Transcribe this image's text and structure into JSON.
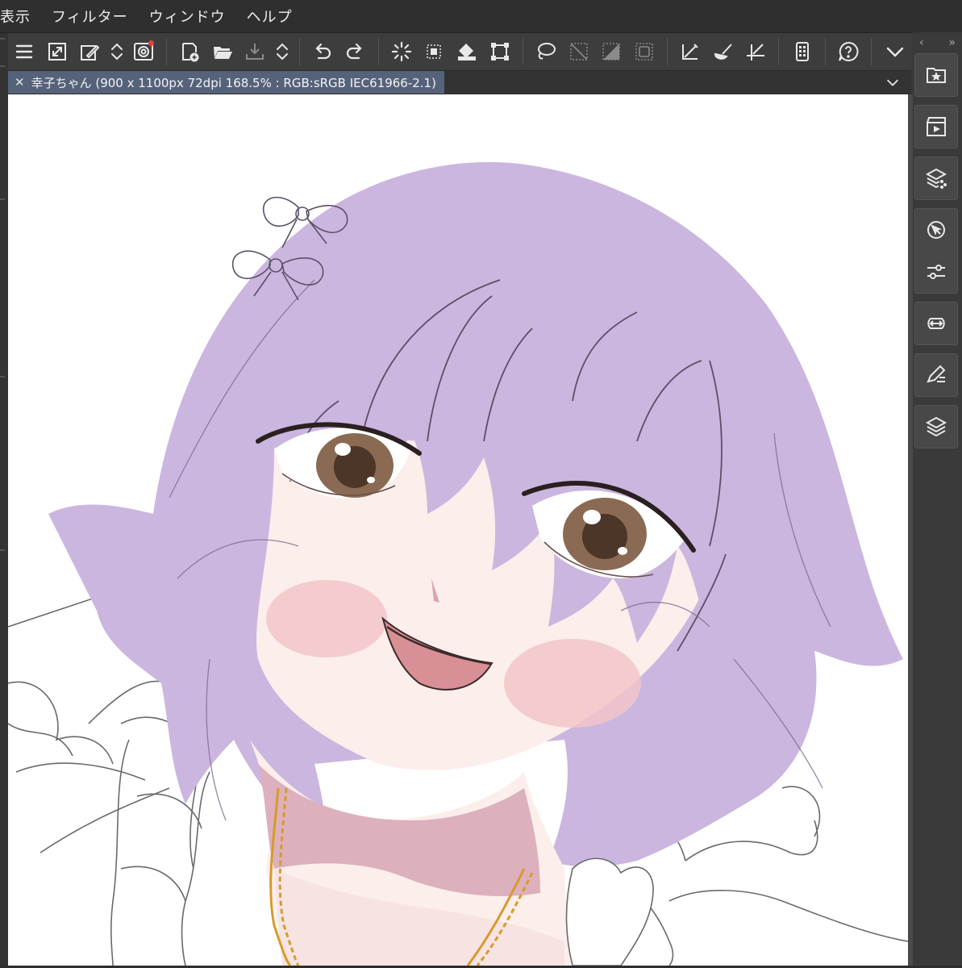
{
  "menu": {
    "items": [
      "表示",
      "フィルター",
      "ウィンドウ",
      "ヘルプ"
    ]
  },
  "toolbar": {
    "buttons": [
      {
        "icon": "menu-icon"
      },
      {
        "icon": "resize-icon"
      },
      {
        "icon": "eyedropper-icon"
      },
      {
        "icon": "up-down-arrows-icon"
      },
      {
        "icon": "clip-studio-logo-icon",
        "notification": true
      },
      {
        "icon": "new-canvas-icon"
      },
      {
        "icon": "open-folder-icon"
      },
      {
        "icon": "save-icon"
      },
      {
        "icon": "up-down-arrows-icon"
      },
      {
        "icon": "undo-icon"
      },
      {
        "icon": "redo-icon"
      },
      {
        "icon": "loading-spinner-icon"
      },
      {
        "icon": "selection-dots-icon"
      },
      {
        "icon": "fill-bucket-icon"
      },
      {
        "icon": "transform-icon"
      },
      {
        "icon": "lasso-icon"
      },
      {
        "icon": "deselect-icon"
      },
      {
        "icon": "invert-selection-icon"
      },
      {
        "icon": "selection-border-icon"
      },
      {
        "icon": "ruler-icon"
      },
      {
        "icon": "brush-icon"
      },
      {
        "icon": "pen-ruler-icon"
      },
      {
        "icon": "companion-mode-icon"
      },
      {
        "icon": "help-icon"
      },
      {
        "icon": "chevron-down-icon"
      }
    ]
  },
  "document": {
    "tab_title": "幸子ちゃん (900 x 1100px 72dpi 168.5% : RGB:sRGB IEC61966-2.1)",
    "close_glyph": "✕"
  },
  "right_panel": {
    "collapse_glyph": "‹",
    "expand_glyph": "»",
    "buttons": [
      {
        "icon": "star-material-icon"
      },
      {
        "icon": "animation-icon"
      },
      {
        "icon": "layer-property-icon"
      },
      {
        "icon": "navigator-icon"
      },
      {
        "icon": "adjust-sliders-icon"
      },
      {
        "icon": "link-arrows-icon"
      },
      {
        "icon": "sub-tool-detail-icon"
      },
      {
        "icon": "layers-icon"
      }
    ]
  },
  "colors": {
    "hair": "#cbb6df",
    "skin": "#fbeeeb",
    "blush": "#f2c6c9",
    "eye_iris": "#8a6a52",
    "mouth": "#d88f95",
    "neck_shadow": "#ddb0bd",
    "chain": "#d79a2b",
    "line": "#4a4a4a",
    "tab_active": "#56627a"
  }
}
